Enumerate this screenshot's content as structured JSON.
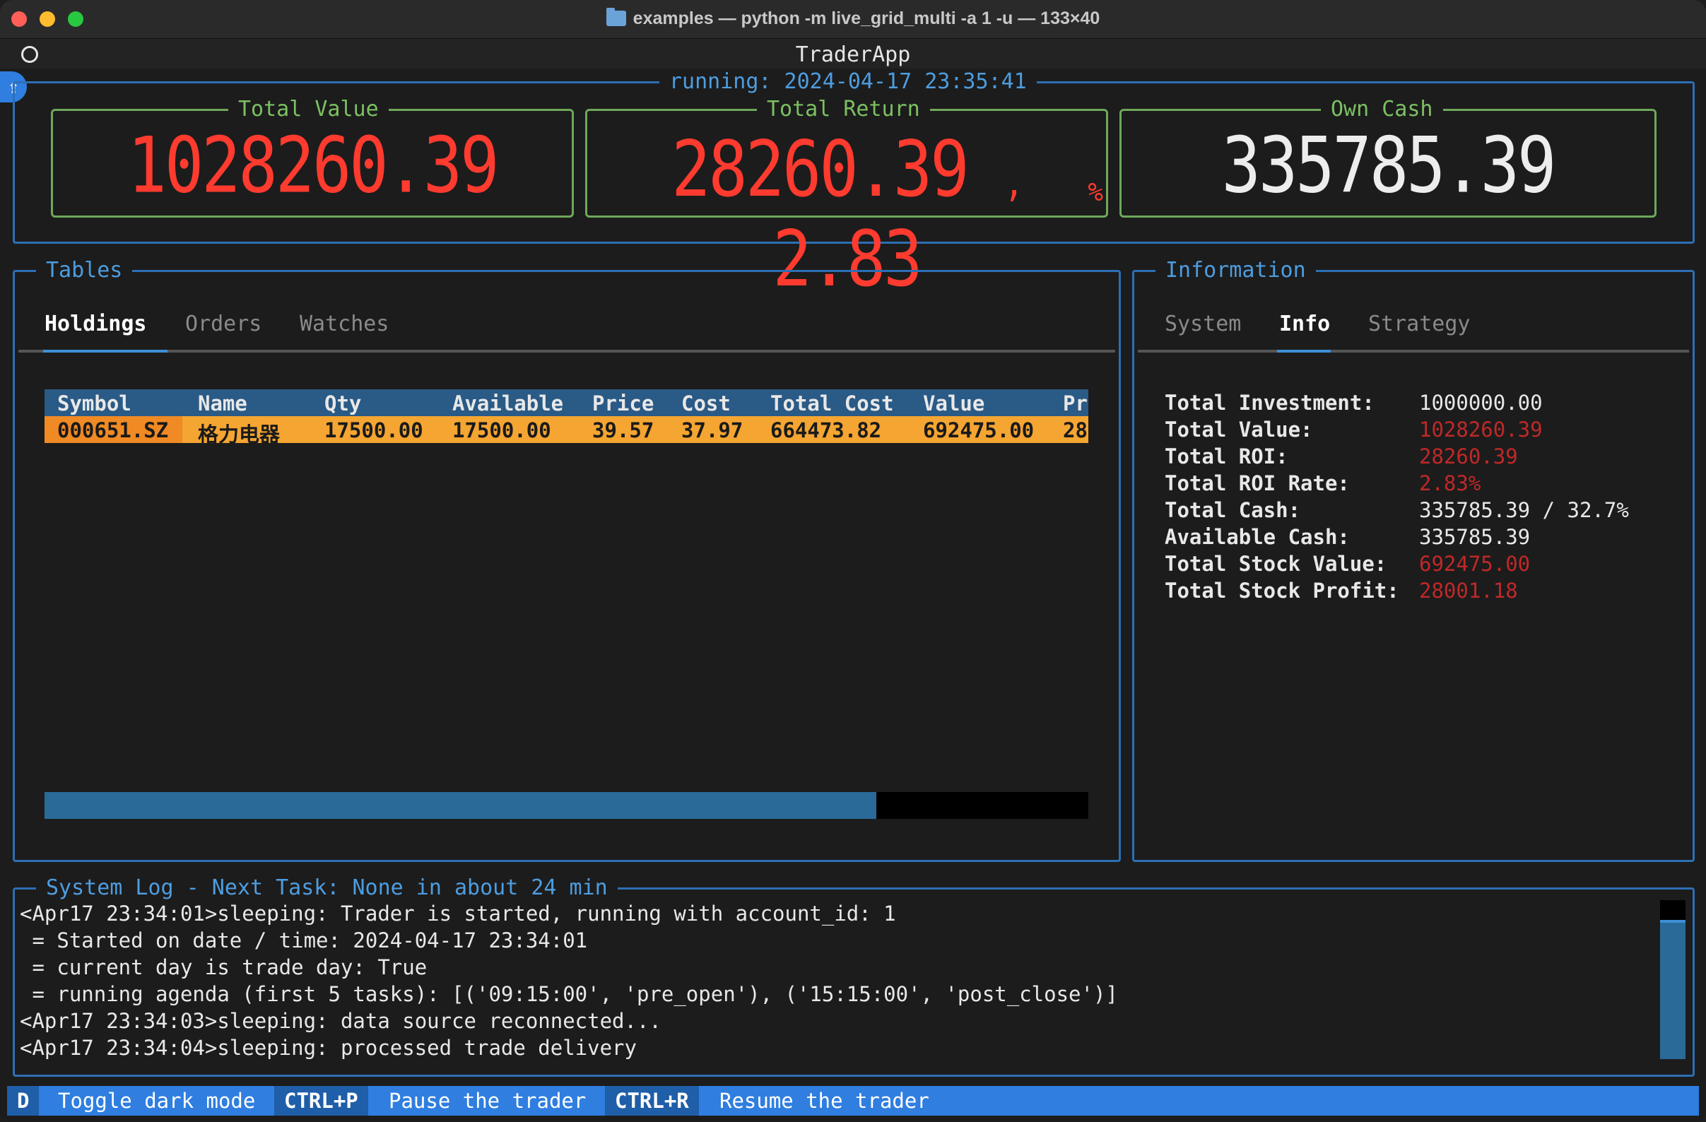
{
  "window": {
    "title": "examples — python -m live_grid_multi -a 1 -u — 133×40"
  },
  "app": {
    "title": "TraderApp",
    "status": "running: 2024-04-17 23:35:41"
  },
  "summary": {
    "total_value": {
      "label": "Total Value",
      "value": "1028260.39"
    },
    "total_return": {
      "label": "Total Return",
      "value": "28260.39",
      "separator": ",",
      "rate": "2.83",
      "unit": "%"
    },
    "own_cash": {
      "label": "Own Cash",
      "value": "335785.39"
    }
  },
  "tables": {
    "title": "Tables",
    "tabs": [
      "Holdings",
      "Orders",
      "Watches"
    ],
    "active_tab": "Holdings",
    "columns": [
      "Symbol",
      "Name",
      "Qty",
      "Available",
      "Price",
      "Cost",
      "Total Cost",
      "Value",
      "Pr"
    ],
    "rows": [
      [
        "000651.SZ",
        "格力电器",
        "17500.00",
        "17500.00",
        "39.57",
        "37.97",
        "664473.82",
        "692475.00",
        "28"
      ]
    ]
  },
  "information": {
    "title": "Information",
    "tabs": [
      "System",
      "Info",
      "Strategy"
    ],
    "active_tab": "Info",
    "items": [
      {
        "label": "Total Investment:",
        "value": "1000000.00",
        "color": "#e8e8e8"
      },
      {
        "label": "Total Value:",
        "value": "1028260.39",
        "color": "#c02828"
      },
      {
        "label": "Total ROI:",
        "value": "28260.39",
        "color": "#c02828"
      },
      {
        "label": "Total ROI Rate:",
        "value": "2.83%",
        "color": "#c02828"
      },
      {
        "label": "Total Cash:",
        "value": "335785.39 / 32.7%",
        "color": "#e8e8e8"
      },
      {
        "label": "Available Cash:",
        "value": "335785.39",
        "color": "#e8e8e8"
      },
      {
        "label": "Total Stock Value:",
        "value": "692475.00",
        "color": "#c02828"
      },
      {
        "label": "Total Stock Profit:",
        "value": "28001.18",
        "color": "#c02828"
      }
    ]
  },
  "log": {
    "title": "System Log - Next Task: None in about 24 min",
    "lines": [
      "<Apr17 23:34:01>sleeping: Trader is started, running with account_id: 1",
      " = Started on date / time: 2024-04-17 23:34:01",
      " = current day is trade day: True",
      " = running agenda (first 5 tasks): [('09:15:00', 'pre_open'), ('15:15:00', 'post_close')]",
      "<Apr17 23:34:03>sleeping: data source reconnected...",
      "<Apr17 23:34:04>sleeping: processed trade delivery"
    ]
  },
  "footer": {
    "bindings": [
      {
        "key": "D",
        "desc": "Toggle dark mode"
      },
      {
        "key": "CTRL+P",
        "desc": "Pause the trader"
      },
      {
        "key": "CTRL+R",
        "desc": "Resume the trader"
      }
    ]
  },
  "colors": {
    "accent": "#2f7ee0",
    "frame_blue": "#2c6fb5",
    "frame_green": "#6fa85a",
    "negative_red": "#ff3b2f",
    "row_highlight": "#f5a531"
  },
  "icons": {
    "window_folder": "folder-icon",
    "header_circle": "circle-icon",
    "edge_badge": "upload-icon"
  }
}
